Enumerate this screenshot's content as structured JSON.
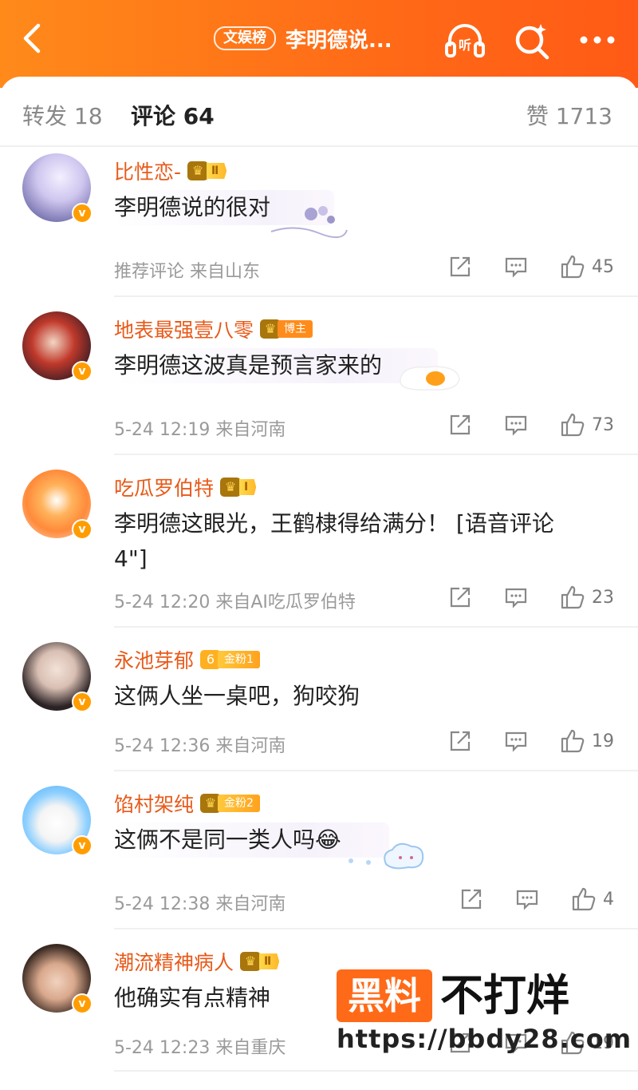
{
  "header": {
    "tag": "文娱榜",
    "title": "李明德说...",
    "listen_label": "听"
  },
  "tabs": {
    "repost": "转发 18",
    "comments": "评论 64",
    "likes": "赞 1713"
  },
  "comments": [
    {
      "name": "比性恋-",
      "badge": "Ⅱ",
      "text": "李明德说的很对",
      "meta": "推荐评论  来自山东",
      "likes": "45"
    },
    {
      "name": "地表最强壹八零",
      "badge": "博主",
      "text": "李明德这波真是预言家来的",
      "meta": "5-24 12:19  来自河南",
      "likes": "73"
    },
    {
      "name": "吃瓜罗伯特",
      "badge": "Ⅰ",
      "text_line1": "李明德这眼光，王鹤棣得给满分！ [语音评论",
      "text_line2": "4\"]",
      "meta": "5-24 12:20  来自AI吃瓜罗伯特",
      "likes": "23"
    },
    {
      "name": "永池芽郁",
      "badge": "金粉1",
      "fan_level": "6",
      "text": "这俩人坐一桌吧，狗咬狗",
      "meta": "5-24 12:36  来自河南",
      "likes": "19"
    },
    {
      "name": "馅村架纯",
      "badge": "金粉2",
      "text": "这俩不是同一类人吗😂",
      "meta": "5-24 12:38  来自河南",
      "likes": "4"
    },
    {
      "name": "潮流精神病人",
      "badge": "Ⅱ",
      "text": "他确实有点精神",
      "meta": "5-24 12:23  来自重庆",
      "likes": "19"
    }
  ],
  "watermark": {
    "box": "黑料",
    "text": "不打烊",
    "url": "https://bbdy28.com"
  },
  "colors": {
    "header_orange": "#ff6a17",
    "name_orange": "#e85a1a",
    "accent": "#ff7a1a"
  }
}
